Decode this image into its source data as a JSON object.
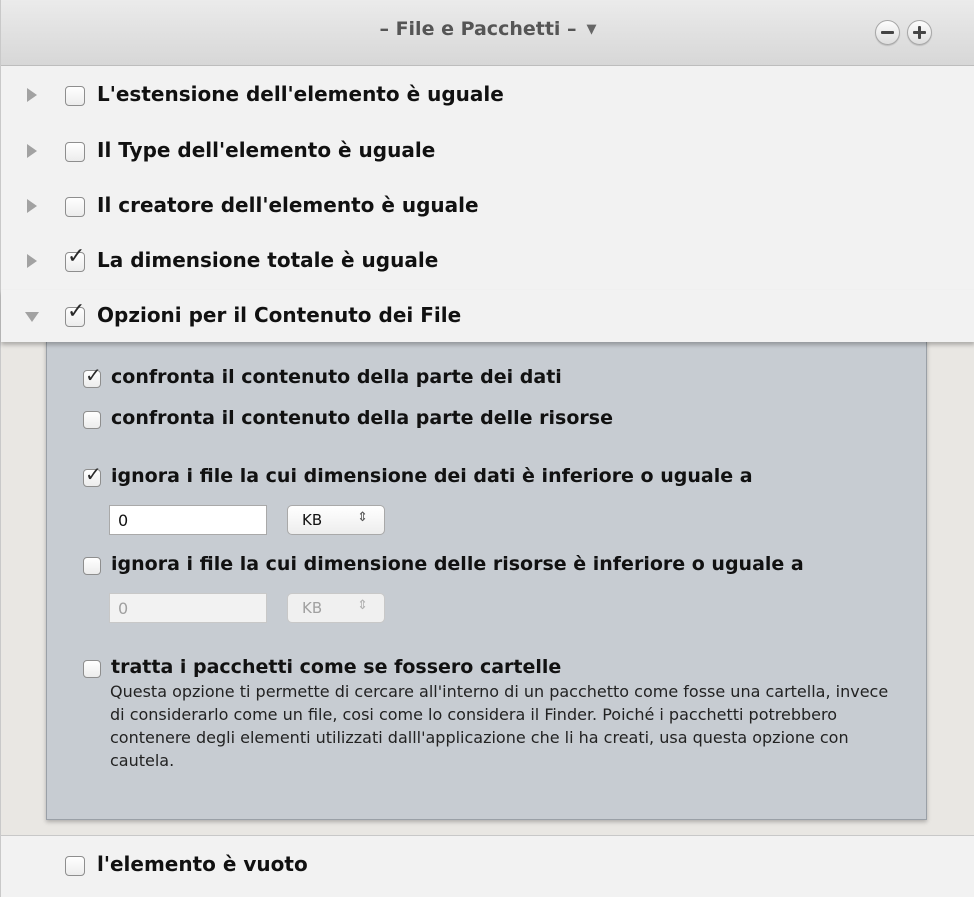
{
  "header": {
    "title": "– File e Pacchetti –",
    "menu_caret": "▼",
    "remove_label": "−",
    "add_label": "+"
  },
  "criteria": [
    {
      "label": "L'estensione dell'elemento è uguale",
      "checked": false,
      "expanded": false
    },
    {
      "label": "Il Type dell'elemento è uguale",
      "checked": false,
      "expanded": false
    },
    {
      "label": "Il creatore dell'elemento è uguale",
      "checked": false,
      "expanded": false
    },
    {
      "label": "La dimensione totale è uguale",
      "checked": true,
      "expanded": false
    },
    {
      "label": "Opzioni per il Contenuto dei File",
      "checked": true,
      "expanded": true
    }
  ],
  "options": {
    "compare_data_fork": {
      "label": "confronta il contenuto della parte dei dati",
      "checked": true
    },
    "compare_resource_fork": {
      "label": "confronta il contenuto della parte delle risorse",
      "checked": false
    },
    "ignore_data_size": {
      "label": "ignora i file la cui dimensione dei dati è inferiore o uguale a",
      "checked": true,
      "value": "0",
      "unit": "KB"
    },
    "ignore_resource_size": {
      "label": "ignora i file la cui dimensione delle risorse è inferiore o uguale a",
      "checked": false,
      "value": "0",
      "unit": "KB"
    },
    "treat_packages": {
      "label": "tratta i pacchetti come se fossero cartelle",
      "checked": false,
      "description": "Questa opzione ti permette di cercare all'interno di un pacchetto come fosse una cartella, invece di considerarlo come un file, cosi come lo considera il Finder. Poiché i pacchetti potrebbero contenere degli elementi utilizzati dalll'applicazione che li ha creati, usa questa opzione con cautela."
    }
  },
  "footer": {
    "empty_item": {
      "label": "l'elemento è vuoto",
      "checked": false
    }
  },
  "icons": {
    "check": "✓",
    "updown": "⇕"
  }
}
